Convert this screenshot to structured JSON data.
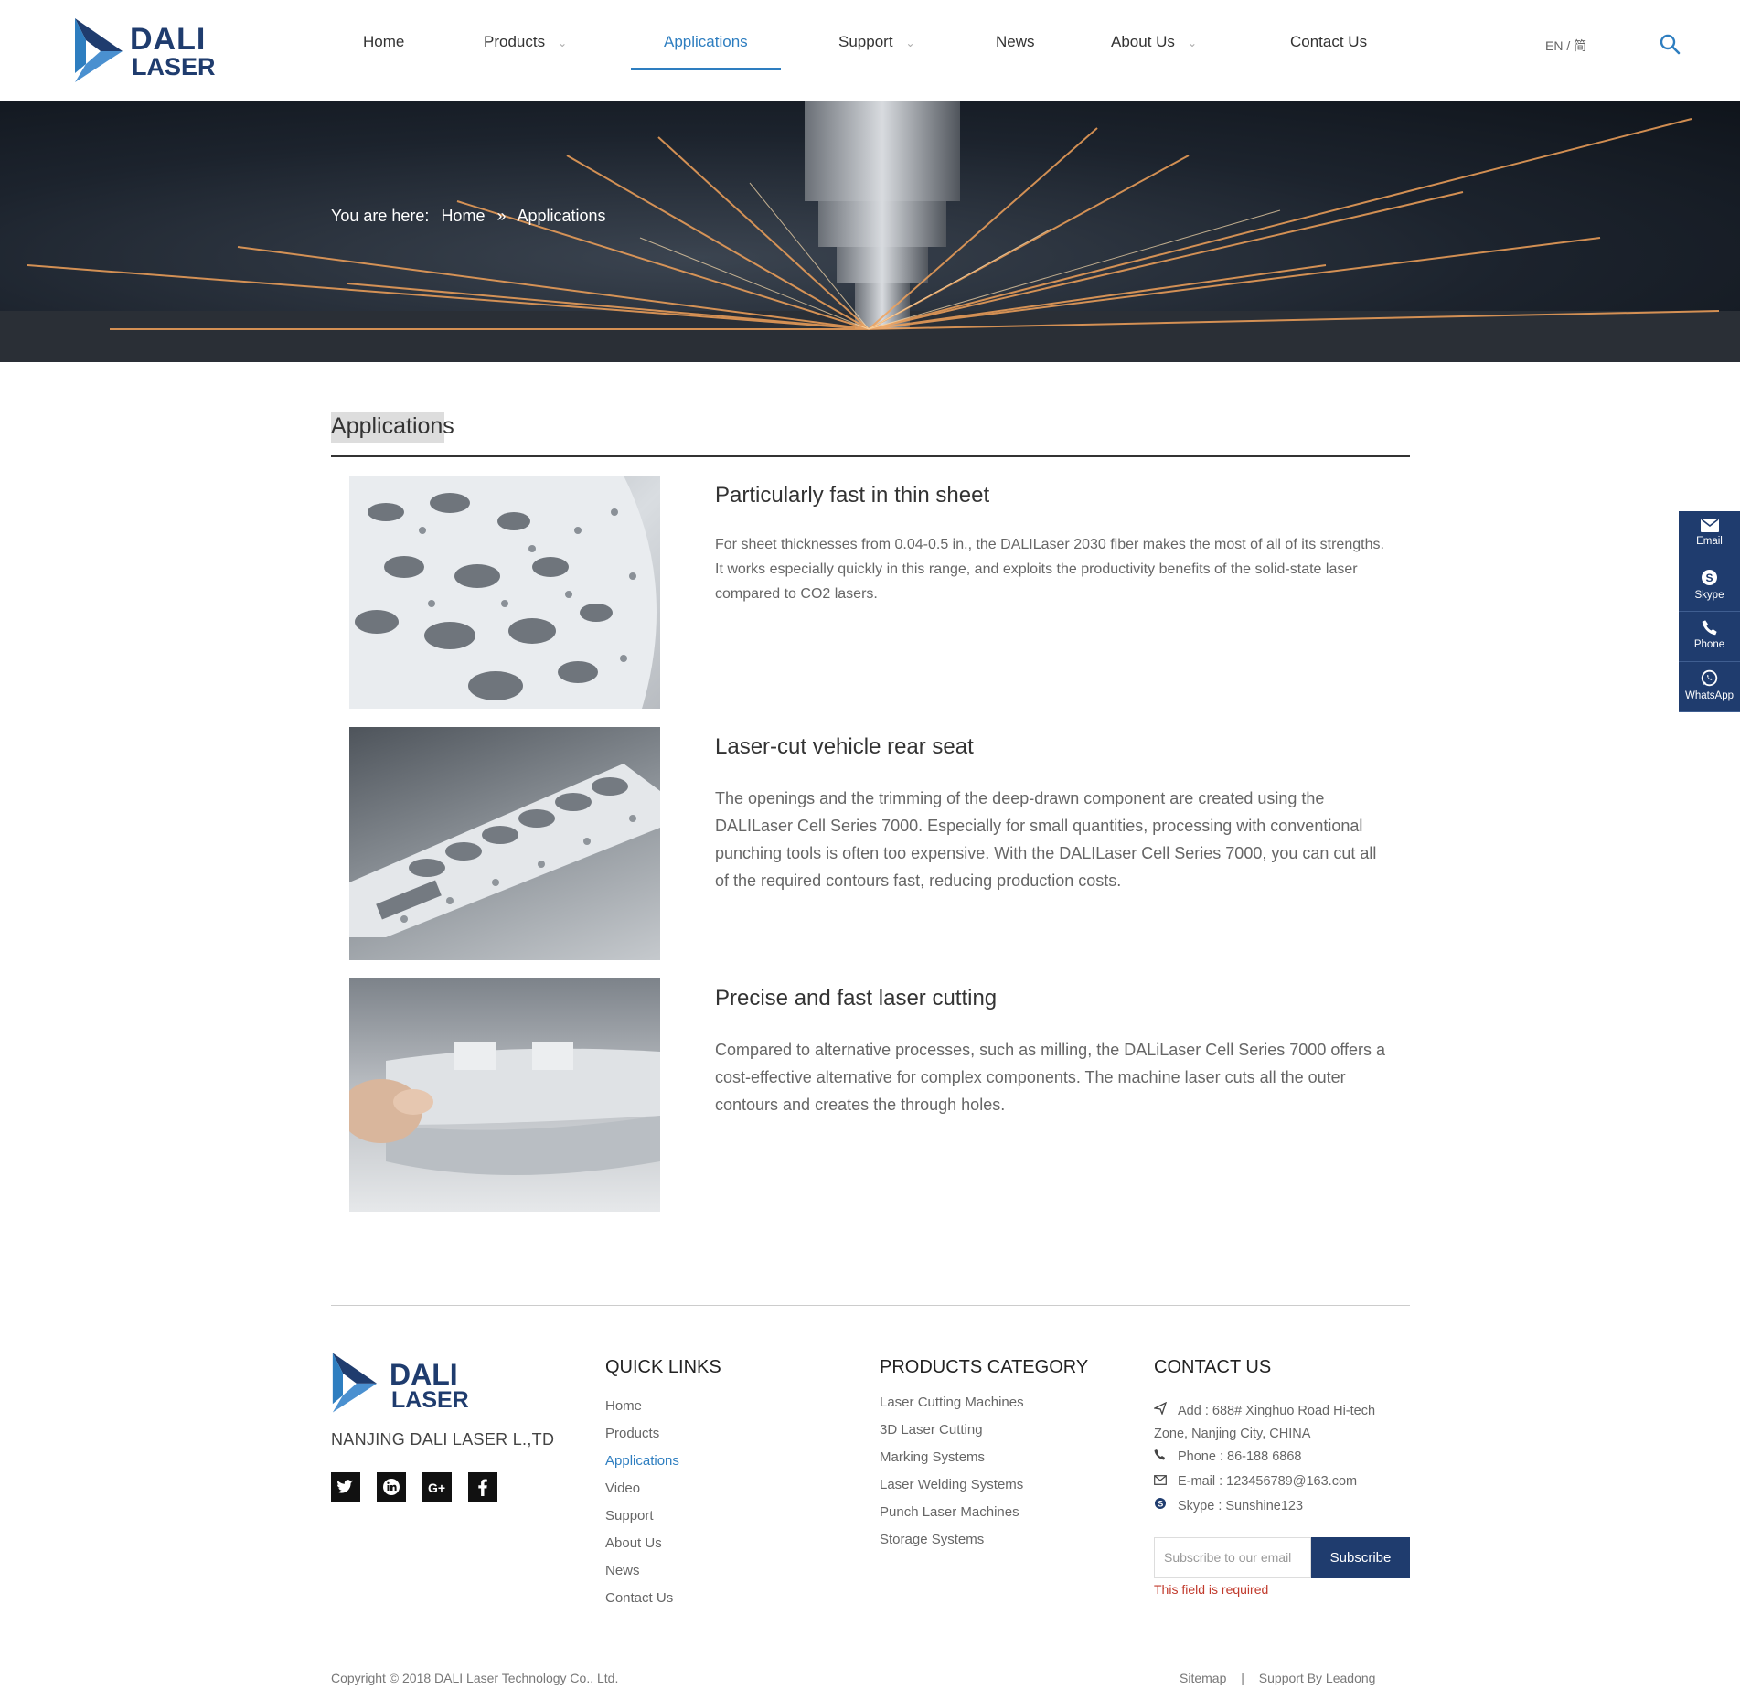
{
  "header": {
    "logo": {
      "line1": "DALI",
      "line2": "LASER"
    },
    "nav": [
      {
        "label": "Home",
        "has_dropdown": false
      },
      {
        "label": "Products",
        "has_dropdown": true
      },
      {
        "label": "Applications",
        "has_dropdown": false,
        "active": true
      },
      {
        "label": "Support",
        "has_dropdown": true
      },
      {
        "label": "News",
        "has_dropdown": false
      },
      {
        "label": "About Us",
        "has_dropdown": true
      },
      {
        "label": "Contact Us",
        "has_dropdown": false
      }
    ],
    "lang": "EN / 简",
    "search_icon": "search-icon"
  },
  "banner": {
    "breadcrumb_prefix": "You are here:",
    "breadcrumb": [
      "Home",
      "»",
      "Applications"
    ]
  },
  "main": {
    "title": "Applications",
    "items": [
      {
        "title": "Particularly fast in thin sheet",
        "description": "For sheet thicknesses from 0.04-0.5 in., the DALILaser 2030 fiber makes the most of all of its strengths. It works especially quickly in this range, and exploits the productivity benefits of the solid-state laser compared to CO2 lasers."
      },
      {
        "title": "Laser-cut vehicle rear seat",
        "description": "The openings and the trimming of the deep-drawn component are created using the DALILaser Cell Series 7000. Especially for small quantities, processing with conventional punching tools is often too expensive. With the DALILaser Cell Series 7000, you can cut all of the required contours fast, reducing production costs."
      },
      {
        "title": "Precise and fast laser cutting",
        "description": "Compared to alternative processes, such as milling, the DALiLaser Cell Series 7000 offers a cost-effective alternative for complex components. The machine laser cuts all the outer contours and creates the through holes."
      }
    ]
  },
  "footer": {
    "logo": {
      "line1": "DALI",
      "line2": "LASER"
    },
    "company": "NANJING DALI LASER L.,TD",
    "social": [
      "twitter-icon",
      "linkedin-icon",
      "google-plus-icon",
      "facebook-icon"
    ],
    "quick_links": {
      "heading": "QUICK LINKS",
      "items": [
        "Home",
        "Products",
        "Applications",
        "Video",
        "Support",
        "About Us",
        "News",
        "Contact Us"
      ]
    },
    "products_category": {
      "heading": "PRODUCTS CATEGORY",
      "items": [
        "Laser Cutting Machines",
        "3D Laser Cutting",
        "Marking Systems",
        "Laser Welding Systems",
        "Punch Laser Machines",
        "Storage Systems"
      ]
    },
    "contact": {
      "heading": "CONTACT US",
      "address_line1": "Add : 688# Xinghuo Road Hi-tech",
      "address_line2": "Zone, Nanjing City, CHINA",
      "phone": "Phone : 86-188 6868",
      "email": "E-mail : 123456789@163.com",
      "skype": "Skype : Sunshine123"
    },
    "subscribe": {
      "placeholder": "Subscribe to our email",
      "button": "Subscribe",
      "error": "This field is required"
    },
    "copyright": "Copyright © 2018  DALI Laser Technology Co., Ltd.",
    "bottom_links": [
      "Sitemap",
      "|",
      "Support By Leadong"
    ]
  },
  "float_bar": [
    {
      "label": "Email",
      "icon": "mail-icon"
    },
    {
      "label": "Skype",
      "icon": "skype-icon"
    },
    {
      "label": "Phone",
      "icon": "phone-icon"
    },
    {
      "label": "WhatsApp",
      "icon": "whatsapp-icon"
    }
  ],
  "colors": {
    "brand_navy": "#1f3c6e",
    "accent_blue": "#2e7ec0",
    "error_red": "#c0392b"
  }
}
